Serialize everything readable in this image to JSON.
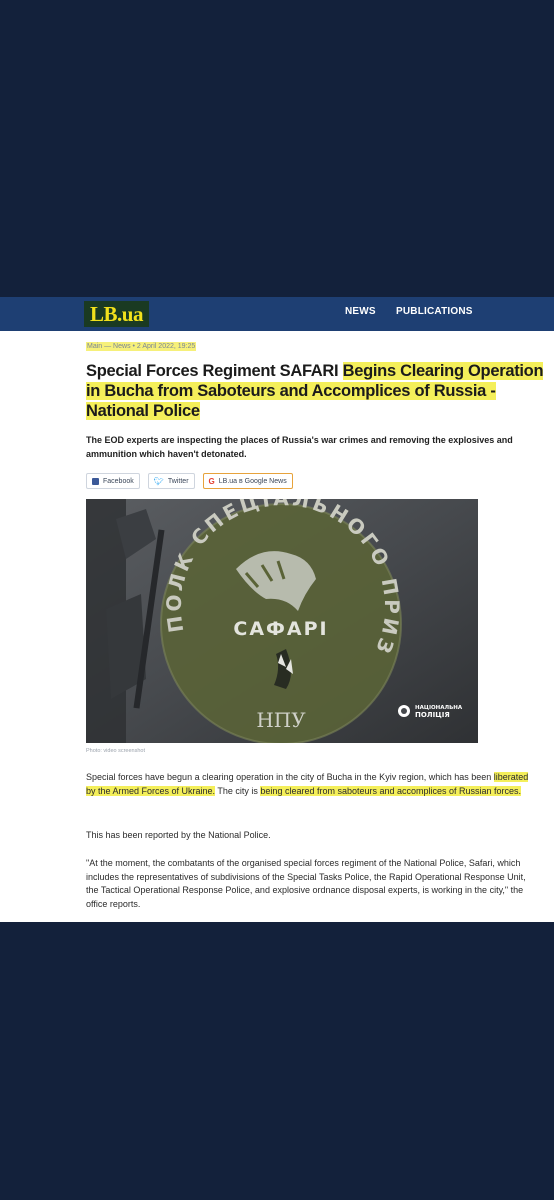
{
  "header": {
    "logo": "LB.ua",
    "nav": [
      "NEWS",
      "PUBLICATIONS"
    ]
  },
  "article": {
    "breadcrumb": "Main — News • 2 April 2022, 19:25",
    "headline_plain": "Special Forces Regiment SAFARI ",
    "headline_highlight": "Begins Clearing Operation in Bucha from Saboteurs and Accomplices of Russia - National Police",
    "lead": "The EOD experts are inspecting the places of Russia's war crimes and removing the explosives and ammunition which haven't detonated.",
    "share": {
      "facebook": "Facebook",
      "twitter": "Twitter",
      "google_news": "LB.ua в Google News"
    },
    "photo": {
      "emblem_arc_text": "ПОЛК СПЕЦІАЛЬНОГО ПРИЗНАЧЕННЯ",
      "emblem_name": "САФАРІ",
      "emblem_abbr": "НПУ",
      "watermark_line1": "НАЦІОНАЛЬНА",
      "watermark_line2": "ПОЛІЦІЯ"
    },
    "caption": "Photo: video screenshot",
    "p1_start": "Special forces have begun a clearing operation in the city of Bucha in the Kyiv region, which has been ",
    "p1_hl1": "liberated by the Armed Forces of Ukraine.",
    "p1_mid": " The city is ",
    "p1_hl2": "being cleared from saboteurs and accomplices of Russian forces.",
    "p2": "This has been reported by the National Police.",
    "p3": "\"At the moment, the combatants of the organised special forces regiment of the National Police, Safari, which includes the representatives of subdivisions of the Special Tasks Police, the Rapid Operational Response Unit, the Tactical Operational Response Police, and explosive ordnance disposal experts, is working in the city,\" the office reports."
  },
  "colors": {
    "background": "#13213b",
    "header": "#1e3f73",
    "logo_yellow": "#f2e11c",
    "highlight": "#f4ef5a"
  }
}
